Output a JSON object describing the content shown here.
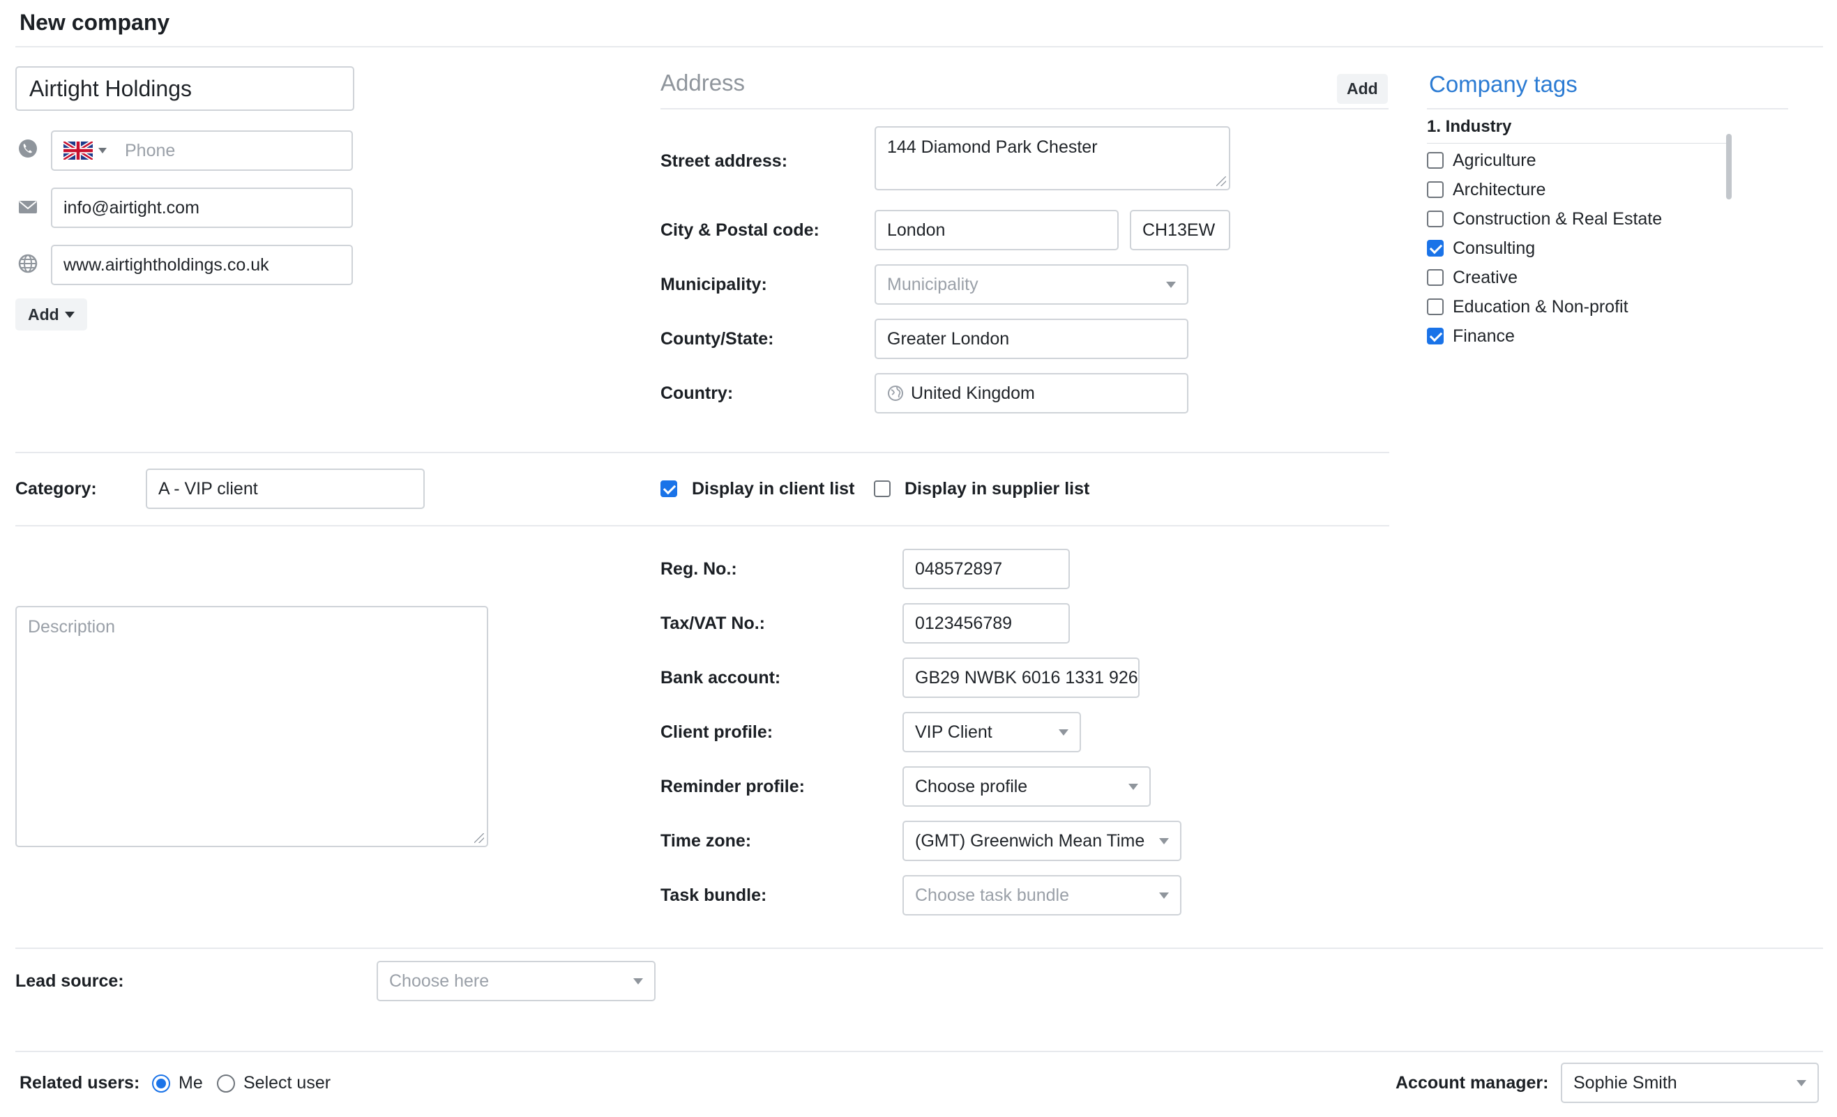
{
  "page": {
    "title": "New company"
  },
  "contact": {
    "company_name": "Airtight Holdings",
    "phone_placeholder": "Phone",
    "email": "info@airtight.com",
    "website": "www.airtightholdings.co.uk",
    "add_label": "Add"
  },
  "address": {
    "title": "Address",
    "add_label": "Add",
    "street_label": "Street address:",
    "street_value": "144 Diamond Park Chester",
    "city_label": "City & Postal code:",
    "city_value": "London",
    "postal_value": "CH13EW",
    "municipality_label": "Municipality:",
    "municipality_placeholder": "Municipality",
    "county_label": "County/State:",
    "county_value": "Greater London",
    "country_label": "Country:",
    "country_value": "United Kingdom"
  },
  "tags": {
    "title": "Company tags",
    "group": "1. Industry",
    "items": [
      {
        "label": "Agriculture",
        "checked": false
      },
      {
        "label": "Architecture",
        "checked": false
      },
      {
        "label": "Construction & Real Estate",
        "checked": false
      },
      {
        "label": "Consulting",
        "checked": true
      },
      {
        "label": "Creative",
        "checked": false
      },
      {
        "label": "Education & Non-profit",
        "checked": false
      },
      {
        "label": "Finance",
        "checked": true
      }
    ]
  },
  "category": {
    "label": "Category:",
    "value": "A - VIP client",
    "client_list_label": "Display in client list",
    "client_list_checked": true,
    "supplier_list_label": "Display in supplier list",
    "supplier_list_checked": false
  },
  "details": {
    "description_placeholder": "Description",
    "reg_label": "Reg. No.:",
    "reg_value": "048572897",
    "tax_label": "Tax/VAT No.:",
    "tax_value": "0123456789",
    "bank_label": "Bank account:",
    "bank_value": "GB29 NWBK 6016 1331 926",
    "client_profile_label": "Client profile:",
    "client_profile_value": "VIP Client",
    "reminder_label": "Reminder profile:",
    "reminder_value": "Choose profile",
    "timezone_label": "Time zone:",
    "timezone_value": "(GMT) Greenwich Mean Time",
    "task_label": "Task bundle:",
    "task_placeholder": "Choose task bundle"
  },
  "lead": {
    "label": "Lead source:",
    "placeholder": "Choose here"
  },
  "footer": {
    "related_label": "Related users:",
    "me_label": "Me",
    "select_user_label": "Select user",
    "account_manager_label": "Account manager:",
    "account_manager_value": "Sophie Smith"
  },
  "colors": {
    "accent": "#1a73e8",
    "tag_title": "#2b7bd3",
    "border": "#cfd3d8"
  }
}
